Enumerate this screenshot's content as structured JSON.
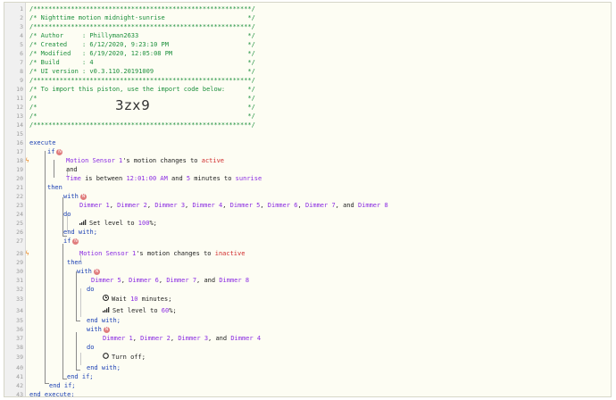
{
  "header_comments": [
    "/**********************************************************/",
    "/* Nighttime motion midnight-sunrise                      */",
    "/**********************************************************/",
    "/* Author     : Phillyman2633                             */",
    "/* Created    : 6/12/2020, 9:23:10 PM                     */",
    "/* Modified   : 6/19/2020, 12:05:08 PM                    */",
    "/* Build      : 4                                         */",
    "/* UI version : v0.3.110.20191009                         */",
    "/**********************************************************/",
    "/* To import this piston, use the import code below:      */",
    "/*                                                        */",
    "/*                                                        */",
    "/*                                                        */",
    "/**********************************************************/"
  ],
  "import_code": "3zx9",
  "line_numbers": [
    "1",
    "2",
    "3",
    "4",
    "5",
    "6",
    "7",
    "8",
    "9",
    "10",
    "11",
    "12",
    "13",
    "14",
    "15",
    "16",
    "17",
    "18",
    "19",
    "20",
    "21",
    "22",
    "23",
    "24",
    "25",
    "26",
    "27",
    "28",
    "29",
    "30",
    "31",
    "32",
    "33",
    "34",
    "35",
    "36",
    "37",
    "38",
    "39",
    "40",
    "41",
    "42",
    "43"
  ],
  "keywords": {
    "execute": "execute",
    "if": "if",
    "and": "and",
    "then": "then",
    "with": "with",
    "do": "do",
    "end_with": "end with;",
    "end_if": "end if;",
    "end_execute": "end execute;"
  },
  "badge": "N",
  "cond1": {
    "device": "Motion Sensor 1",
    "text": "'s motion changes to ",
    "value": "active"
  },
  "cond2": {
    "prefix": "Time",
    "text1": " is between ",
    "t1": "12:01:00 AM",
    "text2": " and ",
    "t2": "5",
    "text3": " minutes to ",
    "t3": "sunrise"
  },
  "with1": {
    "d1": "Dimmer 1",
    "d2": "Dimmer 2",
    "d3": "Dimmer 3",
    "d4": "Dimmer 4",
    "d5": "Dimmer 5",
    "d6": "Dimmer 6",
    "d7": "Dimmer 7",
    "sep": ", ",
    "and": ", and ",
    "d8": "Dimmer 8"
  },
  "task1": {
    "text": "Set level to ",
    "value": "100",
    "suffix": "%;",
    "icon": "signal-bars-icon"
  },
  "cond3": {
    "device": "Motion Sensor 1",
    "text": "'s motion changes to ",
    "value": "inactive"
  },
  "with2": {
    "d5": "Dimmer 5",
    "d6": "Dimmer 6",
    "d7": "Dimmer 7",
    "sep": ", ",
    "and": ", and ",
    "d8": "Dimmer 8"
  },
  "task2": {
    "text": "Wait ",
    "value": "10",
    "suffix": " minutes;",
    "icon": "clock-icon"
  },
  "task3": {
    "text": "Set level to ",
    "value": "60",
    "suffix": "%;",
    "icon": "signal-bars-icon"
  },
  "with3": {
    "d1": "Dimmer 1",
    "d2": "Dimmer 2",
    "d3": "Dimmer 3",
    "sep": ", ",
    "and": ", and ",
    "d4": "Dimmer 4"
  },
  "task4": {
    "text": "Turn off;",
    "icon": "power-icon"
  },
  "colors": {
    "comment": "#1c8f3c",
    "keyword": "#1a3fb3",
    "device": "#8a2be2",
    "value": "#d12c2c",
    "bolt": "#e8821e"
  }
}
